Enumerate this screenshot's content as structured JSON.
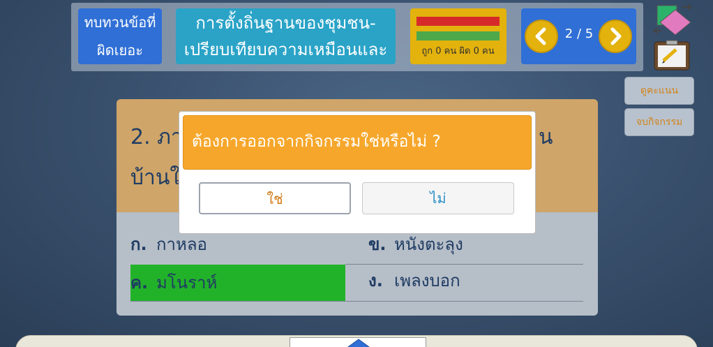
{
  "header": {
    "review_wrong_line1": "ทบทวนข้อที่",
    "review_wrong_line2": "ผิดเยอะ",
    "title_line1": "การตั้งถิ่นฐานของชุมชน-",
    "title_line2": "เปรียบเทียบความเหมือนและ",
    "score_text": "ถูก 0 คน ผิด 0 คน",
    "page_indicator": "2 / 5"
  },
  "colors": {
    "score_bar_red": "#d62a2a",
    "score_bar_green": "#4ea84a",
    "correct_option": "#22b22a",
    "modal_header": "#f6a72b"
  },
  "side_buttons": {
    "view_score": "ดูคะแนน",
    "end_activity": "จบกิจกรรม"
  },
  "question": {
    "line1": "2. ภา",
    "line1_tail": "น",
    "line2": "บ้านใ"
  },
  "options": [
    {
      "letter": "ก.",
      "text": "กาหลอ"
    },
    {
      "letter": "ข.",
      "text": "หนังตะลุง"
    },
    {
      "letter": "ค.",
      "text": "มโนราห์"
    },
    {
      "letter": "ง.",
      "text": "เพลงบอก"
    }
  ],
  "dialog": {
    "message": "ต้องการออกจากกิจกรรมใช่หรือไม่ ?",
    "yes_label": "ใช่",
    "no_label": "ไม่"
  },
  "icons": {
    "left_arrow": "chevron-left-icon",
    "right_arrow": "chevron-right-icon",
    "shuffle": "shuffle-icon",
    "clipboard": "clipboard-icon"
  }
}
